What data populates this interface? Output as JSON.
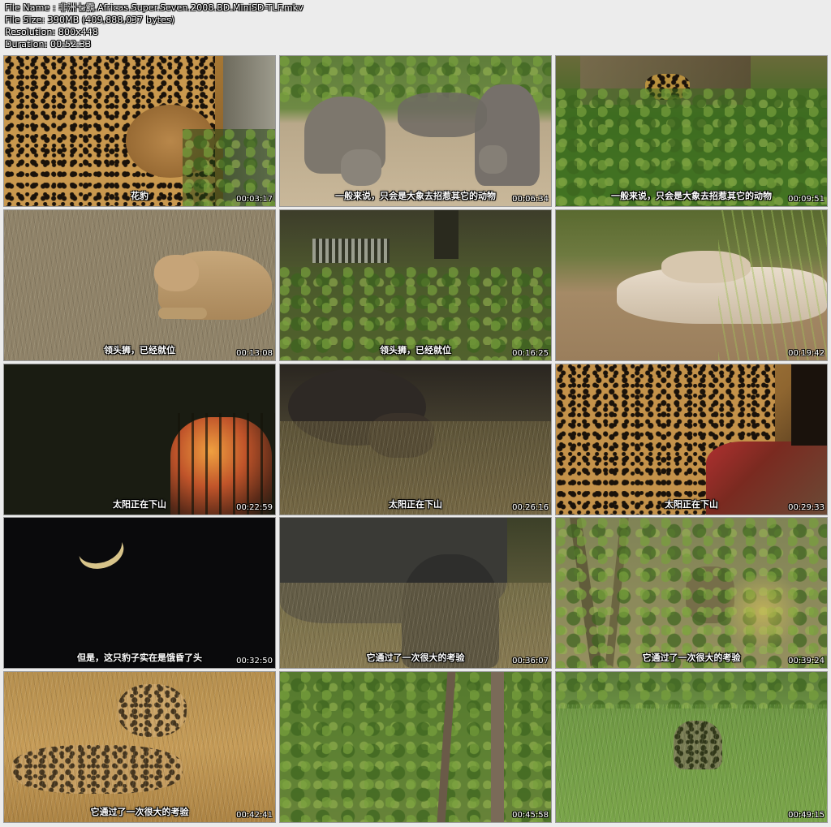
{
  "header": {
    "file_name": "File Name : 非洲七霸.Africas.Super.Seven.2008.BD.MiniSD-TLF.mkv",
    "file_size": "File Size: 390MB (409,888,037 bytes)",
    "resolution": "Resolution: 800x448",
    "duration": "Duration: 00:52:33"
  },
  "thumbnails": [
    {
      "subtitle": "花豹",
      "time": "00:03:17"
    },
    {
      "subtitle": "一般来说，只会是大象去招惹其它的动物",
      "time": "00:06:34"
    },
    {
      "subtitle": "一般来说，只会是大象去招惹其它的动物",
      "time": "00:09:51"
    },
    {
      "subtitle": "领头狮，已经就位",
      "time": "00:13:08"
    },
    {
      "subtitle": "领头狮，已经就位",
      "time": "00:16:25"
    },
    {
      "subtitle": "",
      "time": "00:19:42"
    },
    {
      "subtitle": "太阳正在下山",
      "time": "00:22:59"
    },
    {
      "subtitle": "太阳正在下山",
      "time": "00:26:16"
    },
    {
      "subtitle": "太阳正在下山",
      "time": "00:29:33"
    },
    {
      "subtitle": "但是，这只豹子实在是饿昏了头",
      "time": "00:32:50"
    },
    {
      "subtitle": "它通过了一次很大的考验",
      "time": "00:36:07"
    },
    {
      "subtitle": "它通过了一次很大的考验",
      "time": "00:39:24"
    },
    {
      "subtitle": "它通过了一次很大的考验",
      "time": "00:42:41"
    },
    {
      "subtitle": "",
      "time": "00:45:58"
    },
    {
      "subtitle": "",
      "time": "00:49:15"
    }
  ]
}
